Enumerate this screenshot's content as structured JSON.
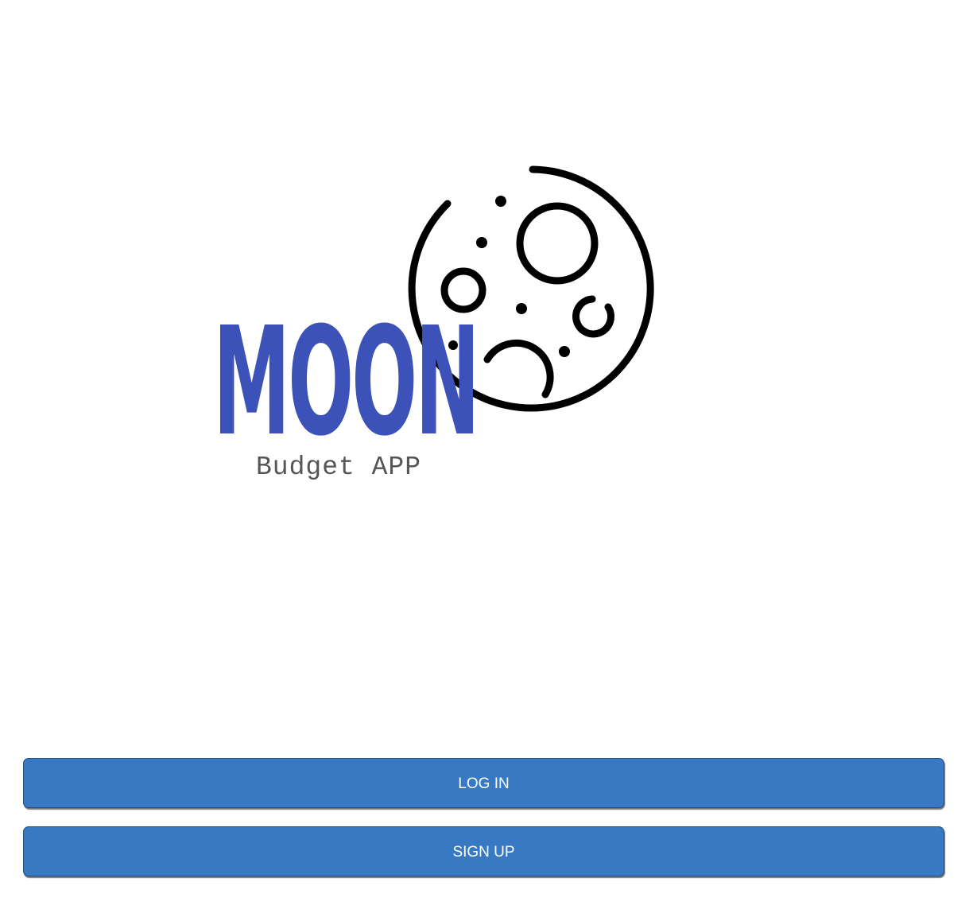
{
  "brand": {
    "name": "MOON",
    "tagline": "Budget APP",
    "name_color": "#3c52b8",
    "icon": "moon-icon"
  },
  "actions": {
    "login_label": "LOG IN",
    "signup_label": "SIGN UP",
    "button_color": "#3779c3"
  }
}
